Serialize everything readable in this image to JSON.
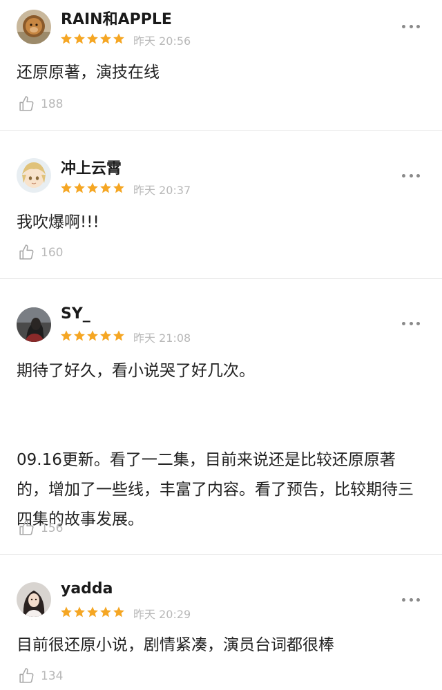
{
  "comments": [
    {
      "username": "RAIN和APPLE",
      "rating": 5,
      "time": "昨天 20:56",
      "paragraphs": [
        "还原原著，演技在线"
      ],
      "likes": "188",
      "avatar_icon": "lion-avatar-icon"
    },
    {
      "username": "冲上云霄",
      "rating": 5,
      "time": "昨天 20:37",
      "paragraphs": [
        "我吹爆啊!!!"
      ],
      "likes": "160",
      "avatar_icon": "anime-boy-avatar-icon"
    },
    {
      "username": "SY_",
      "rating": 5,
      "time": "昨天 21:08",
      "paragraphs": [
        "期待了好久，看小说哭了好几次。",
        "",
        "09.16更新。看了一二集，目前来说还是比较还原原著的，增加了一些线，丰富了内容。看了预告，比较期待三四集的故事发展。"
      ],
      "likes": "156",
      "avatar_icon": "girl-silhouette-avatar-icon"
    },
    {
      "username": "yadda",
      "rating": 5,
      "time": "昨天 20:29",
      "paragraphs": [
        "目前很还原小说，剧情紧凑，演员台词都很棒"
      ],
      "likes": "134",
      "avatar_icon": "girl-photo-avatar-icon"
    }
  ],
  "colors": {
    "star": "#f5a623",
    "muted": "#b8b8b8",
    "divider": "#e6e6e6"
  }
}
